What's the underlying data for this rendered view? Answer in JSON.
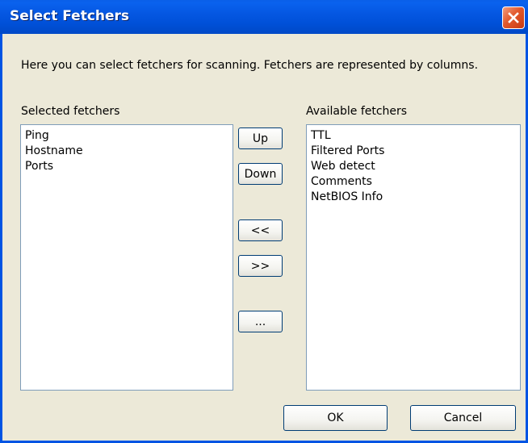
{
  "window": {
    "title": "Select Fetchers"
  },
  "description": "Here you can select fetchers for scanning. Fetchers are represented by columns.",
  "selected": {
    "label": "Selected fetchers",
    "items": [
      "Ping",
      "Hostname",
      "Ports"
    ]
  },
  "available": {
    "label": "Available fetchers",
    "items": [
      "TTL",
      "Filtered Ports",
      "Web detect",
      "Comments",
      "NetBIOS Info"
    ]
  },
  "buttons": {
    "up": "Up",
    "down": "Down",
    "add": "<<",
    "remove": ">>",
    "options": "...",
    "ok": "OK",
    "cancel": "Cancel"
  },
  "icons": {
    "close": "close-icon"
  },
  "colors": {
    "titlebar": "#0054e3",
    "close": "#e2582c",
    "background": "#ece9d8",
    "list_border": "#7f9db9"
  }
}
